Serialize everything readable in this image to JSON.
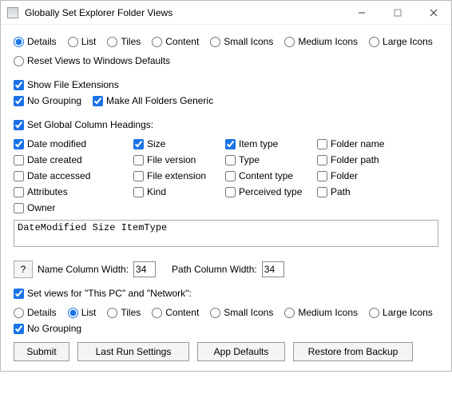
{
  "titlebar": {
    "title": "Globally Set Explorer Folder Views"
  },
  "view_radios": {
    "selected": "Details",
    "options": [
      "Details",
      "List",
      "Tiles",
      "Content",
      "Small Icons",
      "Medium Icons",
      "Large Icons"
    ]
  },
  "reset_views_label": "Reset Views to Windows Defaults",
  "check_show_ext": {
    "label": "Show File Extensions",
    "checked": true
  },
  "check_no_grouping_top": {
    "label": "No Grouping",
    "checked": true
  },
  "check_generic": {
    "label": "Make All Folders Generic",
    "checked": true
  },
  "check_set_columns": {
    "label": "Set Global Column Headings:",
    "checked": true
  },
  "columns": [
    {
      "label": "Date modified",
      "checked": true
    },
    {
      "label": "Size",
      "checked": true
    },
    {
      "label": "Item type",
      "checked": true
    },
    {
      "label": "Folder name",
      "checked": false
    },
    {
      "label": "Date created",
      "checked": false
    },
    {
      "label": "File version",
      "checked": false
    },
    {
      "label": "Type",
      "checked": false
    },
    {
      "label": "Folder path",
      "checked": false
    },
    {
      "label": "Date accessed",
      "checked": false
    },
    {
      "label": "File extension",
      "checked": false
    },
    {
      "label": "Content type",
      "checked": false
    },
    {
      "label": "Folder",
      "checked": false
    },
    {
      "label": "Attributes",
      "checked": false
    },
    {
      "label": "Kind",
      "checked": false
    },
    {
      "label": "Perceived type",
      "checked": false
    },
    {
      "label": "Path",
      "checked": false
    },
    {
      "label": "Owner",
      "checked": false
    }
  ],
  "columns_text": "DateModified Size ItemType",
  "help_label": "?",
  "name_width_label": "Name Column Width:",
  "name_width_value": "34",
  "path_width_label": "Path Column Width:",
  "path_width_value": "34",
  "check_set_thispc": {
    "label": "Set views for \"This PC\" and \"Network\":",
    "checked": true
  },
  "thispc_radios": {
    "selected": "List",
    "options": [
      "Details",
      "List",
      "Tiles",
      "Content",
      "Small Icons",
      "Medium Icons",
      "Large Icons"
    ]
  },
  "check_no_grouping_bottom": {
    "label": "No Grouping",
    "checked": true
  },
  "buttons": {
    "submit": "Submit",
    "last_run": "Last Run Settings",
    "app_defaults": "App Defaults",
    "restore": "Restore from Backup"
  }
}
